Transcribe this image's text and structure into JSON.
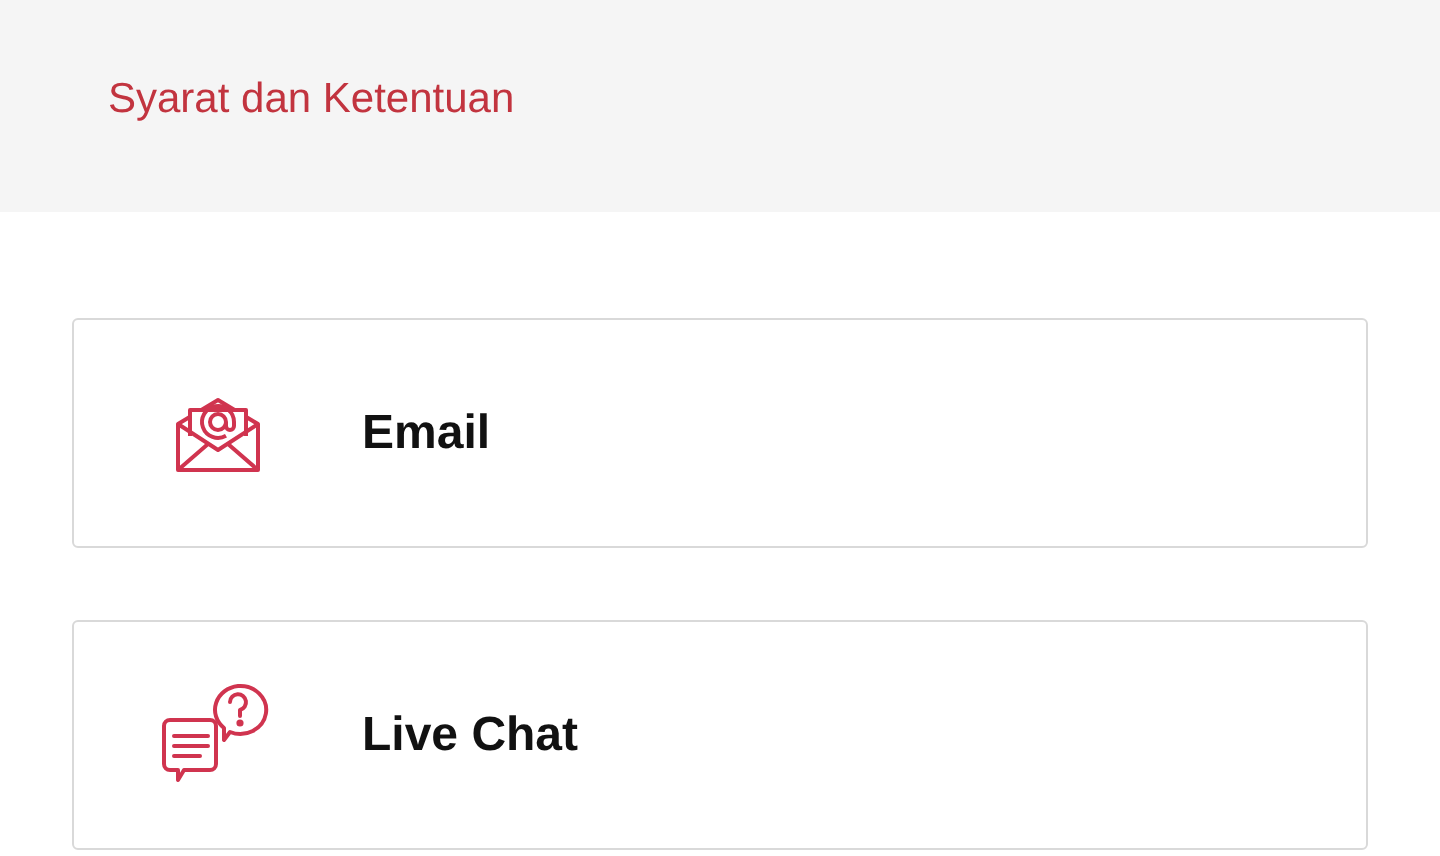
{
  "terms_link": "Syarat dan Ketentuan",
  "contacts": [
    {
      "kind": "email",
      "label": "Email"
    },
    {
      "kind": "chat",
      "label": "Live Chat"
    }
  ]
}
